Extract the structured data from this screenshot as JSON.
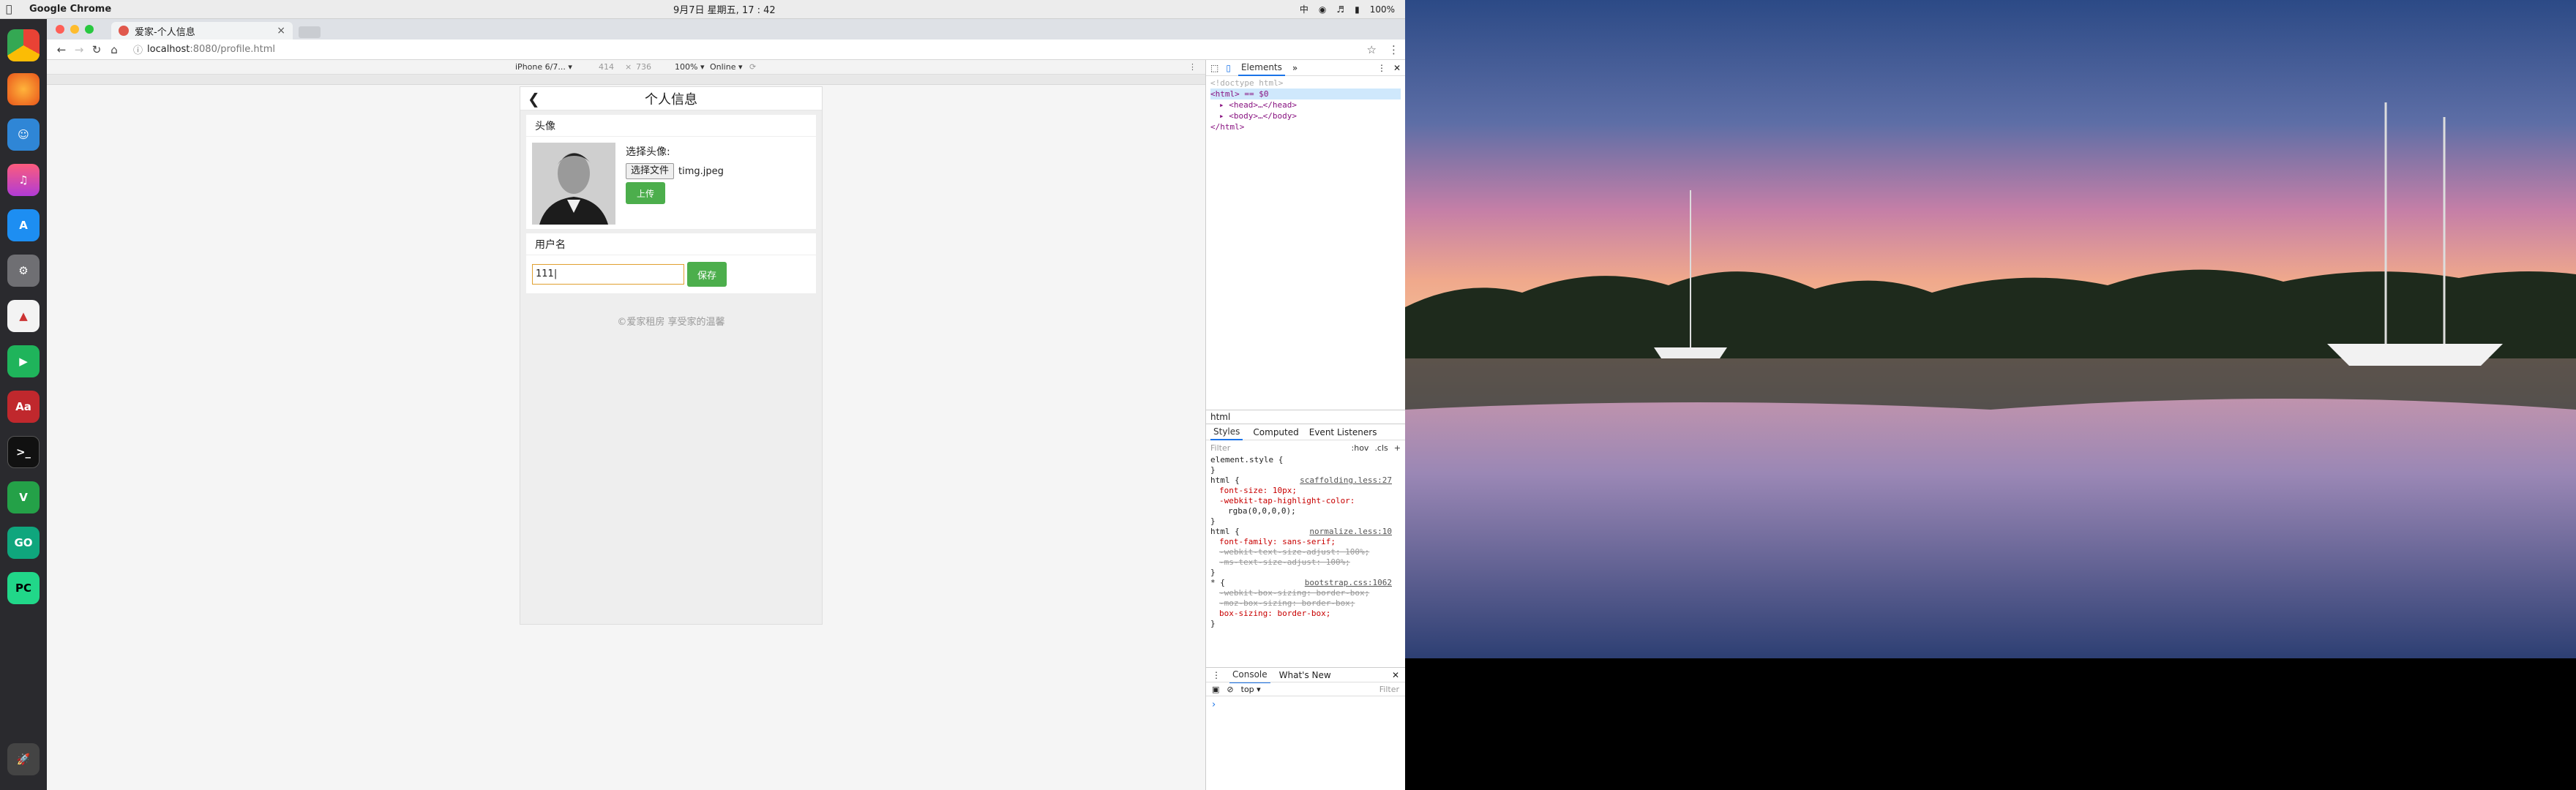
{
  "menubar": {
    "app_name": "Google Chrome",
    "clock": "9月7日 星期五, 17 : 42",
    "battery": "100%"
  },
  "browser": {
    "tab_title": "爱家-个人信息",
    "url_host": "localhost",
    "url_path": ":8080/profile.html"
  },
  "device_toolbar": {
    "device": "iPhone 6/7...",
    "width": "414",
    "times": "×",
    "height": "736",
    "zoom": "100%",
    "network": "Online"
  },
  "page": {
    "title": "个人信息",
    "avatar_section": "头像",
    "choose_label": "选择头像:",
    "file_button": "选择文件",
    "file_name": "timg.jpeg",
    "upload_button": "上传",
    "username_section": "用户名",
    "username_value": "111|",
    "save_button": "保存",
    "footer": "©爱家租房  享受家的温馨"
  },
  "devtools": {
    "tab_elements": "Elements",
    "doctype": "<!doctype html>",
    "html_line": "<html> == $0",
    "head_line": "<head>…</head>",
    "body_line": "<body>…</body>",
    "close_html": "</html>",
    "breadcrumb": "html",
    "styles_tabs": [
      "Styles",
      "Computed",
      "Event Listeners"
    ],
    "filter": "Filter",
    "hov": ":hov",
    "cls": ".cls",
    "console_tab": "Console",
    "whats_new": "What's New",
    "context": "top",
    "console_filter": "Filter",
    "rules": [
      {
        "line": "element.style {",
        "src": ""
      },
      {
        "line": "}",
        "src": ""
      },
      {
        "line": "html {",
        "src": "scaffolding.less:27"
      },
      {
        "line": "font-size: 10px;",
        "src": ""
      },
      {
        "line": "-webkit-tap-highlight-color:",
        "src": ""
      },
      {
        "line": "rgba(0,0,0,0);",
        "src": ""
      },
      {
        "line": "}",
        "src": ""
      },
      {
        "line": "html {",
        "src": "normalize.less:10"
      },
      {
        "line": "font-family: sans-serif;",
        "src": ""
      },
      {
        "line": "-webkit-text-size-adjust: 100%;",
        "src": ""
      },
      {
        "line": "-ms-text-size-adjust: 100%;",
        "src": ""
      },
      {
        "line": "}",
        "src": ""
      },
      {
        "line": "* {",
        "src": "bootstrap.css:1062"
      },
      {
        "line": "-webkit-box-sizing: border-box;",
        "src": ""
      },
      {
        "line": "-moz-box-sizing: border-box;",
        "src": ""
      },
      {
        "line": "box-sizing: border-box;",
        "src": ""
      },
      {
        "line": "}",
        "src": ""
      }
    ]
  },
  "colors": {
    "accent_green": "#4cae4c",
    "devtools_blue": "#1a73e8"
  }
}
